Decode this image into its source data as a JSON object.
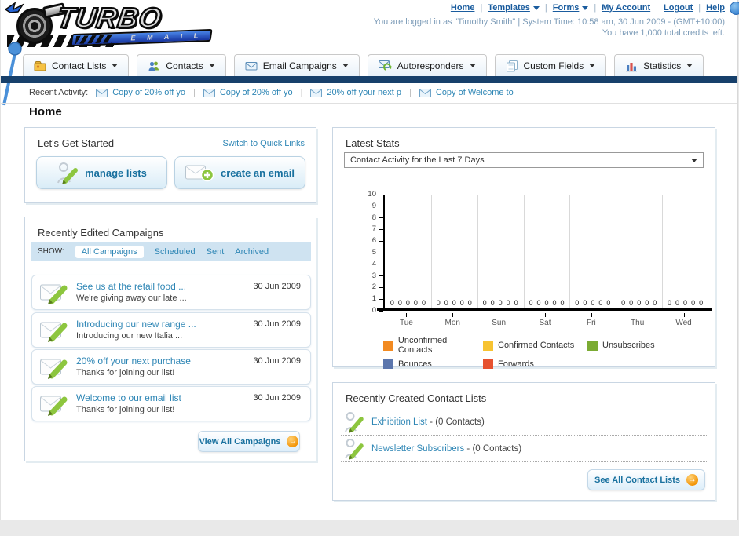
{
  "header": {
    "logo_title": "TURBO",
    "logo_subtitle": "E M A I L",
    "separator": "|",
    "links": [
      {
        "label": "Home",
        "has_caret": false
      },
      {
        "label": "Templates",
        "has_caret": true
      },
      {
        "label": "Forms",
        "has_caret": true
      },
      {
        "label": "My Account",
        "has_caret": false
      },
      {
        "label": "Logout",
        "has_caret": false
      },
      {
        "label": "Help",
        "has_caret": false
      }
    ],
    "login_line": "You are logged in as \"Timothy Smith\" | System Time: 10:58 am, 30 Jun 2009 - (GMT+10:00)",
    "credits_line": "You have 1,000 total credits left."
  },
  "nav": {
    "tabs": [
      {
        "label": "Contact Lists",
        "icon": "folder-icon"
      },
      {
        "label": "Contacts",
        "icon": "people-icon"
      },
      {
        "label": "Email Campaigns",
        "icon": "envelope-icon"
      },
      {
        "label": "Autoresponders",
        "icon": "autoresponder-icon"
      },
      {
        "label": "Custom Fields",
        "icon": "fields-icon"
      },
      {
        "label": "Statistics",
        "icon": "bar-chart-icon"
      }
    ]
  },
  "recent_activity": {
    "label": "Recent Activity:",
    "items": [
      "Copy of 20% off yo",
      "Copy of 20% off yo",
      "20% off your next p",
      "Copy of Welcome to"
    ]
  },
  "page_title": "Home",
  "get_started": {
    "title": "Let's Get Started",
    "switch_link": "Switch to Quick Links",
    "manage_lists_label": "manage lists",
    "create_email_label": "create an email"
  },
  "campaigns": {
    "title": "Recently Edited Campaigns",
    "show_label": "SHOW:",
    "tabs": [
      "All Campaigns",
      "Scheduled",
      "Sent",
      "Archived"
    ],
    "active_tab": "All Campaigns",
    "items": [
      {
        "title": "See us at the retail food ...",
        "subtitle": "We're giving away our late ...",
        "date": "30 Jun 2009"
      },
      {
        "title": "Introducing our new range ...",
        "subtitle": "Introducing our new Italia ...",
        "date": "30 Jun 2009"
      },
      {
        "title": "20% off your next purchase",
        "subtitle": "Thanks for joining our list!",
        "date": "30 Jun 2009"
      },
      {
        "title": "Welcome to our email list",
        "subtitle": "Thanks for joining our list!",
        "date": "30 Jun 2009"
      }
    ],
    "view_all_label": "View All Campaigns"
  },
  "stats": {
    "title": "Latest Stats",
    "dropdown_value": "Contact Activity for the Last 7 Days"
  },
  "chart_data": {
    "type": "bar",
    "title": "Contact Activity for the Last 7 Days",
    "categories": [
      "Tue",
      "Mon",
      "Sun",
      "Sat",
      "Fri",
      "Thu",
      "Wed"
    ],
    "series": [
      {
        "name": "Unconfirmed Contacts",
        "color": "#F28A21",
        "values": [
          0,
          0,
          0,
          0,
          0,
          0,
          0
        ]
      },
      {
        "name": "Confirmed Contacts",
        "color": "#F7C331",
        "values": [
          0,
          0,
          0,
          0,
          0,
          0,
          0
        ]
      },
      {
        "name": "Unsubscribes",
        "color": "#7BAB33",
        "values": [
          0,
          0,
          0,
          0,
          0,
          0,
          0
        ]
      },
      {
        "name": "Bounces",
        "color": "#5B76AD",
        "values": [
          0,
          0,
          0,
          0,
          0,
          0,
          0
        ]
      },
      {
        "name": "Forwards",
        "color": "#E6512F",
        "values": [
          0,
          0,
          0,
          0,
          0,
          0,
          0
        ]
      }
    ],
    "ylim": [
      0,
      10
    ],
    "yticks": [
      0,
      1,
      2,
      3,
      4,
      5,
      6,
      7,
      8,
      9,
      10
    ],
    "grid": "vertical-day-separators",
    "legend_position": "bottom",
    "value_labels_shown": true
  },
  "contact_lists": {
    "title": "Recently Created Contact Lists",
    "items": [
      {
        "name": "Exhibition List",
        "suffix": " - (0 Contacts)"
      },
      {
        "name": "Newsletter Subscribers",
        "suffix": " - (0 Contacts)"
      }
    ],
    "see_all_label": "See All Contact Lists"
  },
  "colors": {
    "navy_bar": "#17406b",
    "link_teal": "#2e86b5",
    "header_link": "#1a5c9e",
    "button_text": "#19719f",
    "orange_arrow": "#f29100"
  }
}
